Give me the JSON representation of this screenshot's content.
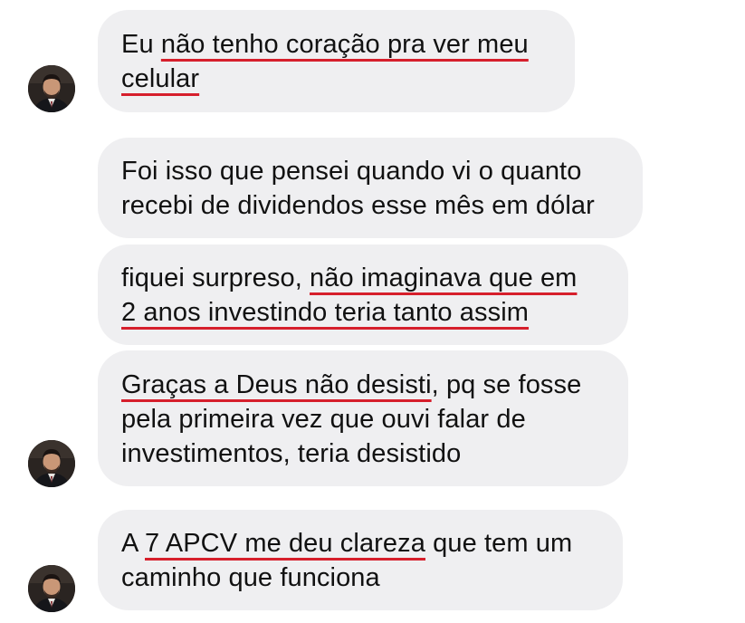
{
  "messages": [
    {
      "id": "m1",
      "lines": [
        [
          {
            "t": "Eu ",
            "u": false
          },
          {
            "t": "não tenho coração pra ver meu",
            "u": true
          }
        ],
        [
          {
            "t": "celular",
            "u": true
          }
        ]
      ]
    },
    {
      "id": "m2",
      "lines": [
        [
          {
            "t": "Foi isso que pensei quando vi o quanto",
            "u": false
          }
        ],
        [
          {
            "t": "recebi de dividendos esse mês em dólar",
            "u": false
          }
        ]
      ]
    },
    {
      "id": "m3",
      "lines": [
        [
          {
            "t": "fiquei surpreso, ",
            "u": false
          },
          {
            "t": "não imaginava que em",
            "u": true
          }
        ],
        [
          {
            "t": "2 anos investindo teria tanto assim",
            "u": true
          }
        ]
      ]
    },
    {
      "id": "m4",
      "lines": [
        [
          {
            "t": "Graças a Deus não desisti",
            "u": true
          },
          {
            "t": ", pq se fosse",
            "u": false
          }
        ],
        [
          {
            "t": "pela primeira vez que ouvi falar de",
            "u": false
          }
        ],
        [
          {
            "t": "investimentos, teria desistido",
            "u": false
          }
        ]
      ]
    },
    {
      "id": "m5",
      "lines": [
        [
          {
            "t": "A ",
            "u": false
          },
          {
            "t": "7 APCV me deu clareza",
            "u": true
          },
          {
            "t": " que tem um",
            "u": false
          }
        ],
        [
          {
            "t": "caminho que funciona",
            "u": false
          }
        ]
      ]
    }
  ],
  "colors": {
    "bubble_bg": "#efeff1",
    "text": "#111111",
    "underline": "#d61f2c"
  },
  "icons": {
    "avatar": "user-profile-photo"
  }
}
